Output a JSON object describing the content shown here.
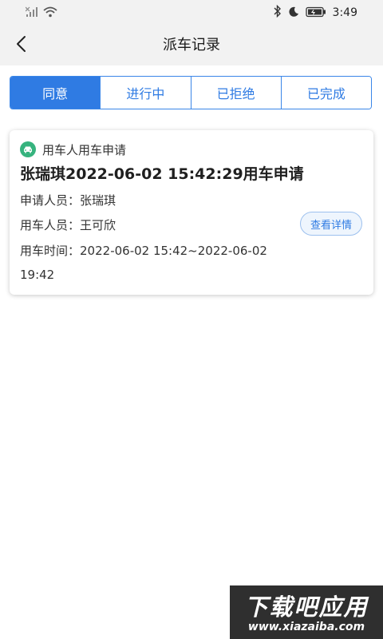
{
  "status_bar": {
    "time": "3:49",
    "icons": [
      "signal-icon",
      "wifi-icon",
      "bluetooth-icon",
      "moon-icon",
      "battery-icon"
    ]
  },
  "header": {
    "title": "派车记录"
  },
  "tabs": [
    {
      "label": "同意",
      "active": true
    },
    {
      "label": "进行中",
      "active": false
    },
    {
      "label": "已拒绝",
      "active": false
    },
    {
      "label": "已完成",
      "active": false
    }
  ],
  "records": [
    {
      "type_label": "用车人用车申请",
      "title": "张瑞琪2022-06-02 15:42:29用车申请",
      "applicant_key": "申请人员：",
      "applicant": "张瑞琪",
      "user_key": "用车人员：",
      "user": "王可欣",
      "time_key": "用车时间：",
      "time_line1": "2022-06-02 15:42~2022-06-02",
      "time_line2": "19:42",
      "detail_label": "查看详情"
    }
  ],
  "watermark": {
    "main": "下载吧应用",
    "sub": "www.xiazaiba.com"
  },
  "colors": {
    "accent": "#2f7be3",
    "car_badge": "#36b37e"
  }
}
